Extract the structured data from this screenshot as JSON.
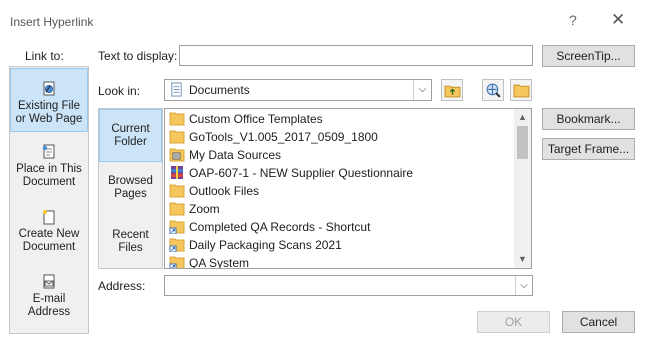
{
  "window": {
    "title": "Insert Hyperlink",
    "help_glyph": "?",
    "close_glyph": "✕"
  },
  "link_to": {
    "label": "Link to:",
    "items": [
      {
        "line1": "Existing File",
        "line2": "or Web Page",
        "icon": "existing-file-web-page-icon",
        "selected": true
      },
      {
        "line1": "Place in This",
        "line2": "Document",
        "icon": "place-in-document-icon"
      },
      {
        "line1": "Create New",
        "line2": "Document",
        "icon": "create-new-document-icon"
      },
      {
        "line1": "E-mail",
        "line2": "Address",
        "icon": "email-address-icon"
      }
    ]
  },
  "text_to_display": {
    "label": "Text to display:",
    "value": ""
  },
  "screentip_label": "ScreenTip...",
  "look_in": {
    "label": "Look in:",
    "value": "Documents"
  },
  "nav": [
    {
      "line1": "Current",
      "line2": "Folder",
      "selected": true
    },
    {
      "line1": "Browsed",
      "line2": "Pages"
    },
    {
      "line1": "Recent",
      "line2": "Files"
    }
  ],
  "files": [
    {
      "name": "Custom Office Templates",
      "icon": "folder-icon"
    },
    {
      "name": "GoTools_V1.005_2017_0509_1800",
      "icon": "folder-icon"
    },
    {
      "name": "My Data Sources",
      "icon": "data-sources-folder-icon"
    },
    {
      "name": "OAP-607-1 - NEW Supplier Questionnaire",
      "icon": "archive-icon"
    },
    {
      "name": "Outlook Files",
      "icon": "folder-icon"
    },
    {
      "name": "Zoom",
      "icon": "folder-icon"
    },
    {
      "name": "Completed QA Records - Shortcut",
      "icon": "shortcut-icon"
    },
    {
      "name": "Daily Packaging Scans 2021",
      "icon": "shortcut-icon"
    },
    {
      "name": "QA System",
      "icon": "shortcut-icon"
    }
  ],
  "bookmark_label": "Bookmark...",
  "target_frame_label": "Target Frame...",
  "address": {
    "label": "Address:",
    "value": ""
  },
  "ok_label": "OK",
  "cancel_label": "Cancel",
  "colors": {
    "selected_bg": "#cce4f7",
    "selected_border": "#99c9ef",
    "folder": "#f5c65b"
  }
}
